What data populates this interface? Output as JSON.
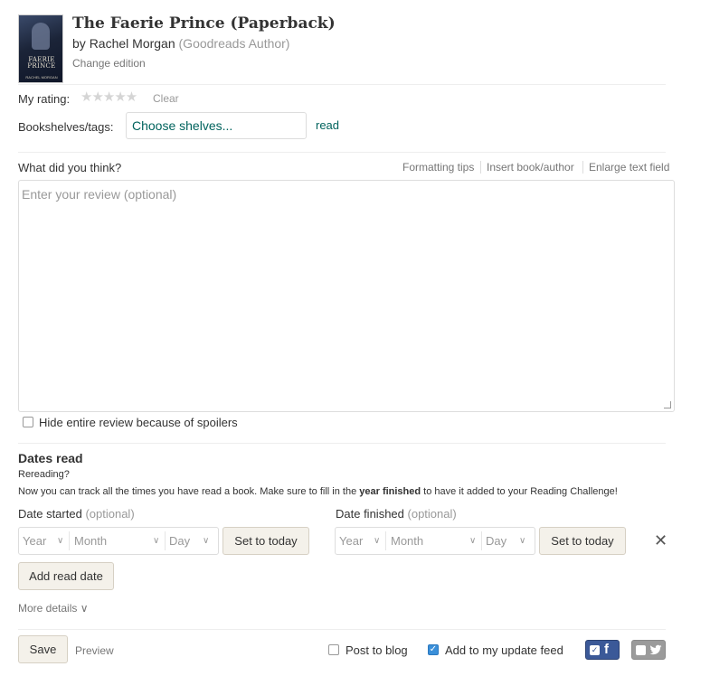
{
  "book": {
    "title": "The Faerie Prince (Paperback)",
    "by": "by",
    "author": "Rachel Morgan",
    "author_role": "(Goodreads Author)",
    "change_edition": "Change edition",
    "cover_title": "FAERIE PRINCE",
    "cover_author": "RACHEL MORGAN"
  },
  "rating": {
    "label": "My rating:",
    "stars": "★★★★★",
    "value": 0,
    "clear": "Clear"
  },
  "shelves": {
    "label": "Bookshelves/tags:",
    "placeholder": "Choose shelves...",
    "current_tag": "read"
  },
  "review": {
    "heading": "What did you think?",
    "tools": [
      "Formatting tips",
      "Insert book/author",
      "Enlarge text field"
    ],
    "placeholder": "Enter your review (optional)",
    "spoiler_label": "Hide entire review because of spoilers",
    "spoiler_checked": false
  },
  "dates": {
    "heading": "Dates read",
    "rereading": "Rereading?",
    "note_before": "Now you can track all the times you have read a book. Make sure to fill in the ",
    "note_bold": "year finished",
    "note_after": " to have it added to your Reading Challenge!",
    "started_label": "Date started",
    "finished_label": "Date finished",
    "optional": "(optional)",
    "year": "Year",
    "month": "Month",
    "day": "Day",
    "set_today": "Set to today",
    "add_read_date": "Add read date",
    "remove_icon": "close-icon"
  },
  "more_details": "More details ∨",
  "footer": {
    "save": "Save",
    "preview": "Preview",
    "post_to_blog": "Post to blog",
    "post_to_blog_checked": false,
    "add_to_feed": "Add to my update feed",
    "add_to_feed_checked": true,
    "facebook_checked": true,
    "twitter_checked": false
  },
  "colors": {
    "accent_green": "#00635d",
    "button_bg": "#f4f1ea",
    "facebook": "#3b5998",
    "checkbox_blue": "#3a8fd9"
  }
}
